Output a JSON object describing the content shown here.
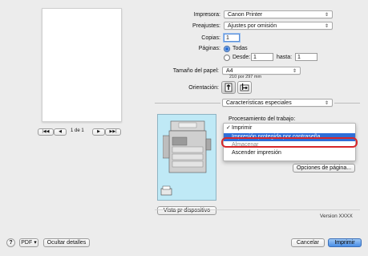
{
  "preview": {
    "page_counter": "1 de 1",
    "first_btn": "|◀◀",
    "prev_btn": "◀",
    "next_btn": "▶",
    "last_btn": "▶▶|"
  },
  "printer": {
    "label": "Impresora:",
    "value": "Canon Printer"
  },
  "presets": {
    "label": "Preajustes:",
    "value": "Ajustes por omisión"
  },
  "copies": {
    "label": "Copias:",
    "value": "1"
  },
  "pages": {
    "label": "Páginas:",
    "all_label": "Todas",
    "from_label": "Desde:",
    "from_value": "1",
    "to_label": "hasta:",
    "to_value": "1"
  },
  "paper_size": {
    "label": "Tamaño del papel:",
    "value": "A4",
    "dims": "210 por 297 mm"
  },
  "orientation": {
    "label": "Orientación:"
  },
  "section_select": {
    "value": "Características especiales"
  },
  "job_processing": {
    "label": "Procesamiento del trabajo:",
    "menu": [
      {
        "label": "Imprimir",
        "checked": true
      },
      {
        "label": "Impresión protegida por contraseña",
        "highlighted": true
      },
      {
        "label": "Almacenar"
      },
      {
        "label": "Ascender impresión"
      }
    ]
  },
  "page_options_btn": "Opciones de página...",
  "device_view_btn": "Vista pr dispositivo",
  "version": "Version XXXX",
  "footer": {
    "help": "?",
    "pdf": "PDF ▾",
    "hide_details": "Ocultar detalles",
    "cancel": "Cancelar",
    "print": "Imprimir"
  },
  "colors": {
    "accent": "#2a6fd6",
    "preview_bg": "#bfe9f6",
    "highlight_ring": "#d6272b"
  },
  "icons": [
    "portrait-orientation-icon",
    "landscape-orientation-icon",
    "printer-device-icon",
    "finisher-icon",
    "help-icon",
    "checkmark-icon"
  ]
}
